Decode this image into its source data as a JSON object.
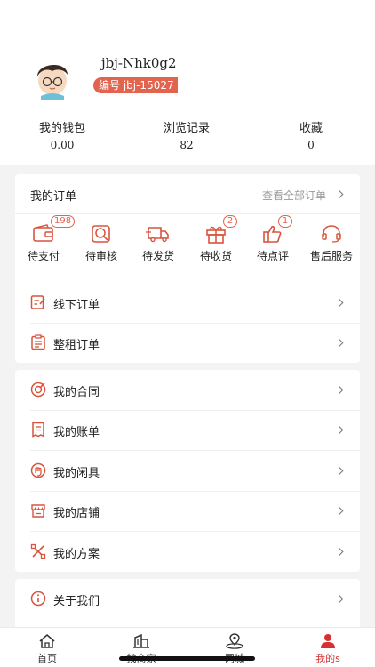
{
  "profile": {
    "username": "jbj-Nhk0g2",
    "badge": "编号 jbj-15027"
  },
  "stats": [
    {
      "label": "我的钱包",
      "value": "0.00"
    },
    {
      "label": "浏览记录",
      "value": "82"
    },
    {
      "label": "收藏",
      "value": "0"
    }
  ],
  "orders": {
    "title": "我的订单",
    "see_all": "查看全部订单",
    "items": [
      {
        "label": "待支付",
        "icon": "wallet-icon",
        "count": "198"
      },
      {
        "label": "待审核",
        "icon": "review-icon",
        "count": ""
      },
      {
        "label": "待发货",
        "icon": "truck-icon",
        "count": ""
      },
      {
        "label": "待收货",
        "icon": "gift-icon",
        "count": "2"
      },
      {
        "label": "待点评",
        "icon": "thumbs-up-icon",
        "count": "1"
      },
      {
        "label": "售后服务",
        "icon": "headset-icon",
        "count": ""
      }
    ],
    "rows": [
      {
        "label": "线下订单",
        "icon": "offline-order-icon"
      },
      {
        "label": "整租订单",
        "icon": "rental-order-icon"
      }
    ]
  },
  "menu": [
    {
      "label": "我的合同",
      "icon": "contract-icon"
    },
    {
      "label": "我的账单",
      "icon": "bill-icon"
    },
    {
      "label": "我的闲具",
      "icon": "idle-tools-icon"
    },
    {
      "label": "我的店铺",
      "icon": "shop-icon"
    },
    {
      "label": "我的方案",
      "icon": "plan-icon"
    }
  ],
  "about": {
    "label": "关于我们",
    "icon": "info-icon"
  },
  "tabs": [
    {
      "label": "首页",
      "icon": "home-icon"
    },
    {
      "label": "找商家",
      "icon": "buildings-icon"
    },
    {
      "label": "同城",
      "icon": "location-icon"
    },
    {
      "label": "我的s",
      "icon": "user-icon"
    }
  ],
  "colors": {
    "accent": "#e2644f",
    "active_tab": "#d73030"
  }
}
